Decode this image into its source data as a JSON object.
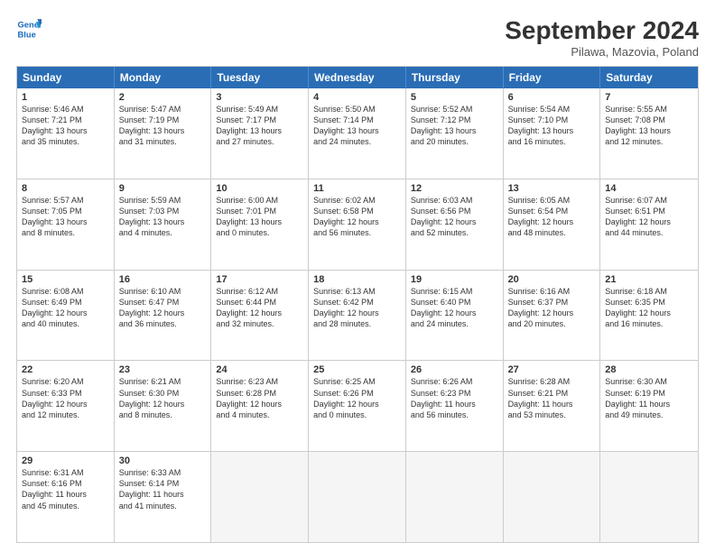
{
  "header": {
    "logo_line1": "General",
    "logo_line2": "Blue",
    "month_title": "September 2024",
    "location": "Pilawa, Mazovia, Poland"
  },
  "weekdays": [
    "Sunday",
    "Monday",
    "Tuesday",
    "Wednesday",
    "Thursday",
    "Friday",
    "Saturday"
  ],
  "rows": [
    [
      {
        "day": "",
        "info": ""
      },
      {
        "day": "2",
        "info": "Sunrise: 5:47 AM\nSunset: 7:19 PM\nDaylight: 13 hours\nand 31 minutes."
      },
      {
        "day": "3",
        "info": "Sunrise: 5:49 AM\nSunset: 7:17 PM\nDaylight: 13 hours\nand 27 minutes."
      },
      {
        "day": "4",
        "info": "Sunrise: 5:50 AM\nSunset: 7:14 PM\nDaylight: 13 hours\nand 24 minutes."
      },
      {
        "day": "5",
        "info": "Sunrise: 5:52 AM\nSunset: 7:12 PM\nDaylight: 13 hours\nand 20 minutes."
      },
      {
        "day": "6",
        "info": "Sunrise: 5:54 AM\nSunset: 7:10 PM\nDaylight: 13 hours\nand 16 minutes."
      },
      {
        "day": "7",
        "info": "Sunrise: 5:55 AM\nSunset: 7:08 PM\nDaylight: 13 hours\nand 12 minutes."
      }
    ],
    [
      {
        "day": "8",
        "info": "Sunrise: 5:57 AM\nSunset: 7:05 PM\nDaylight: 13 hours\nand 8 minutes."
      },
      {
        "day": "9",
        "info": "Sunrise: 5:59 AM\nSunset: 7:03 PM\nDaylight: 13 hours\nand 4 minutes."
      },
      {
        "day": "10",
        "info": "Sunrise: 6:00 AM\nSunset: 7:01 PM\nDaylight: 13 hours\nand 0 minutes."
      },
      {
        "day": "11",
        "info": "Sunrise: 6:02 AM\nSunset: 6:58 PM\nDaylight: 12 hours\nand 56 minutes."
      },
      {
        "day": "12",
        "info": "Sunrise: 6:03 AM\nSunset: 6:56 PM\nDaylight: 12 hours\nand 52 minutes."
      },
      {
        "day": "13",
        "info": "Sunrise: 6:05 AM\nSunset: 6:54 PM\nDaylight: 12 hours\nand 48 minutes."
      },
      {
        "day": "14",
        "info": "Sunrise: 6:07 AM\nSunset: 6:51 PM\nDaylight: 12 hours\nand 44 minutes."
      }
    ],
    [
      {
        "day": "15",
        "info": "Sunrise: 6:08 AM\nSunset: 6:49 PM\nDaylight: 12 hours\nand 40 minutes."
      },
      {
        "day": "16",
        "info": "Sunrise: 6:10 AM\nSunset: 6:47 PM\nDaylight: 12 hours\nand 36 minutes."
      },
      {
        "day": "17",
        "info": "Sunrise: 6:12 AM\nSunset: 6:44 PM\nDaylight: 12 hours\nand 32 minutes."
      },
      {
        "day": "18",
        "info": "Sunrise: 6:13 AM\nSunset: 6:42 PM\nDaylight: 12 hours\nand 28 minutes."
      },
      {
        "day": "19",
        "info": "Sunrise: 6:15 AM\nSunset: 6:40 PM\nDaylight: 12 hours\nand 24 minutes."
      },
      {
        "day": "20",
        "info": "Sunrise: 6:16 AM\nSunset: 6:37 PM\nDaylight: 12 hours\nand 20 minutes."
      },
      {
        "day": "21",
        "info": "Sunrise: 6:18 AM\nSunset: 6:35 PM\nDaylight: 12 hours\nand 16 minutes."
      }
    ],
    [
      {
        "day": "22",
        "info": "Sunrise: 6:20 AM\nSunset: 6:33 PM\nDaylight: 12 hours\nand 12 minutes."
      },
      {
        "day": "23",
        "info": "Sunrise: 6:21 AM\nSunset: 6:30 PM\nDaylight: 12 hours\nand 8 minutes."
      },
      {
        "day": "24",
        "info": "Sunrise: 6:23 AM\nSunset: 6:28 PM\nDaylight: 12 hours\nand 4 minutes."
      },
      {
        "day": "25",
        "info": "Sunrise: 6:25 AM\nSunset: 6:26 PM\nDaylight: 12 hours\nand 0 minutes."
      },
      {
        "day": "26",
        "info": "Sunrise: 6:26 AM\nSunset: 6:23 PM\nDaylight: 11 hours\nand 56 minutes."
      },
      {
        "day": "27",
        "info": "Sunrise: 6:28 AM\nSunset: 6:21 PM\nDaylight: 11 hours\nand 53 minutes."
      },
      {
        "day": "28",
        "info": "Sunrise: 6:30 AM\nSunset: 6:19 PM\nDaylight: 11 hours\nand 49 minutes."
      }
    ],
    [
      {
        "day": "29",
        "info": "Sunrise: 6:31 AM\nSunset: 6:16 PM\nDaylight: 11 hours\nand 45 minutes."
      },
      {
        "day": "30",
        "info": "Sunrise: 6:33 AM\nSunset: 6:14 PM\nDaylight: 11 hours\nand 41 minutes."
      },
      {
        "day": "",
        "info": ""
      },
      {
        "day": "",
        "info": ""
      },
      {
        "day": "",
        "info": ""
      },
      {
        "day": "",
        "info": ""
      },
      {
        "day": "",
        "info": ""
      }
    ]
  ],
  "row0_sunday": {
    "day": "1",
    "info": "Sunrise: 5:46 AM\nSunset: 7:21 PM\nDaylight: 13 hours\nand 35 minutes."
  }
}
